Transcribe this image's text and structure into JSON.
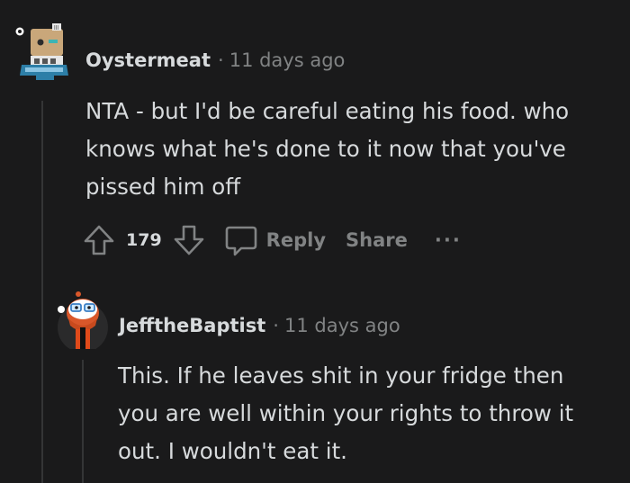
{
  "comments": [
    {
      "username": "Oystermeat",
      "separator": "·",
      "time": "11 days ago",
      "body": "NTA - but I'd be careful eating his food. who knows what he's done to it now that you've pissed him off",
      "votes": "179",
      "actions": {
        "reply": "Reply",
        "share": "Share",
        "more": "···"
      }
    },
    {
      "username": "JefftheBaptist",
      "separator": "·",
      "time": "11 days ago",
      "body": "This. If he leaves shit in your fridge then you are well within your rights to throw it out. I wouldn't eat it."
    }
  ],
  "colors": {
    "background": "#1a1a1b",
    "text": "#d7dadc",
    "muted": "#818384",
    "thread_line": "#343536"
  },
  "icons": [
    "upvote-icon",
    "downvote-icon",
    "comment-bubble-icon",
    "more-icon"
  ]
}
